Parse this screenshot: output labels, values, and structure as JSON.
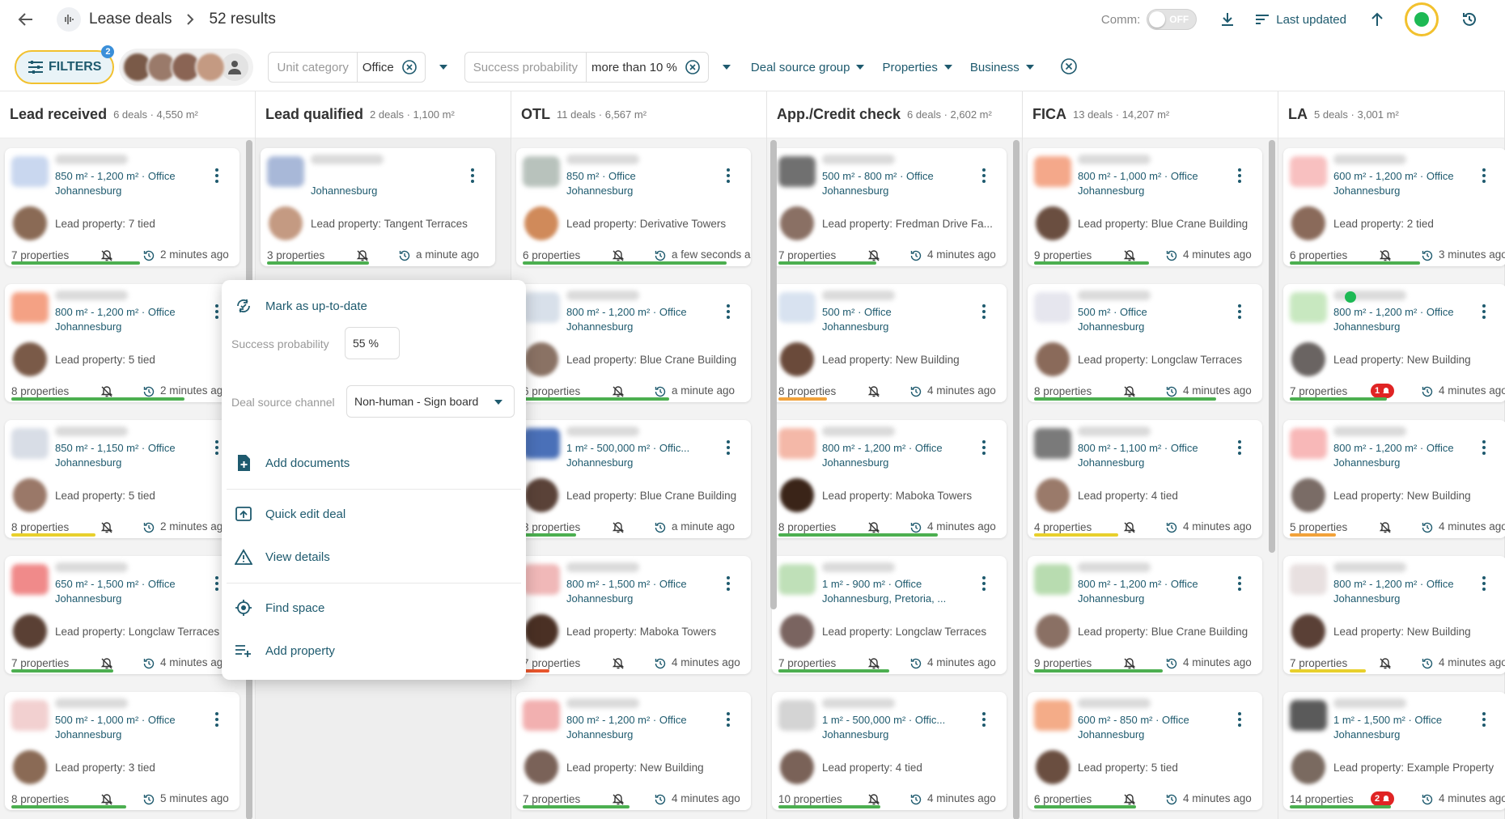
{
  "header": {
    "title": "Lease deals",
    "results": "52 results",
    "comm_label": "Comm:",
    "comm_toggle": "OFF",
    "sort_label": "Last updated"
  },
  "filters": {
    "button_label": "FILTERS",
    "badge": "2",
    "unit_category": {
      "label": "Unit category",
      "value": "Office"
    },
    "success_probability": {
      "label": "Success probability",
      "value": "more than 10 %"
    },
    "dropdowns": [
      "Deal source group",
      "Properties",
      "Business"
    ]
  },
  "columns": [
    {
      "title": "Lead received",
      "meta": "6 deals · 4,550 m²"
    },
    {
      "title": "Lead qualified",
      "meta": "2 deals · 1,100 m²"
    },
    {
      "title": "OTL",
      "meta": "11 deals · 6,567 m²"
    },
    {
      "title": "App./Credit check",
      "meta": "6 deals · 2,602 m²"
    },
    {
      "title": "FICA",
      "meta": "13 deals · 14,207 m²"
    },
    {
      "title": "LA",
      "meta": "5 deals · 3,001 m²"
    }
  ],
  "cards": [
    [
      {
        "size": "850 m² - 1,200 m² · Office",
        "city": "Johannesburg",
        "lead": "Lead property: 7 tied",
        "props": "7 properties",
        "time": "2 minutes ago",
        "bar": "#4caf50",
        "bar_fill": 0.58,
        "thumb": "#c9d7ef",
        "agent": "#8a6a55"
      },
      {
        "size": "800 m² - 1,200 m² · Office",
        "city": "Johannesburg",
        "lead": "Lead property: 5 tied",
        "props": "8 properties",
        "time": "2 minutes ago",
        "bar": "#4caf50",
        "bar_fill": 0.78,
        "thumb": "#f4a184",
        "agent": "#7a5a48"
      },
      {
        "size": "850 m² - 1,150 m² · Office",
        "city": "Johannesburg",
        "lead": "Lead property: 5 tied",
        "props": "8 properties",
        "time": "2 minutes ago",
        "bar": "#e8d02c",
        "bar_fill": 0.38,
        "thumb": "#d8dde6",
        "agent": "#9a7868"
      },
      {
        "size": "650 m² - 1,500 m² · Office",
        "city": "Johannesburg",
        "lead": "Lead property: Longclaw Terraces",
        "props": "7 properties",
        "time": "4 minutes ago",
        "bar": "#4caf50",
        "bar_fill": 0.46,
        "thumb": "#f08a8a",
        "agent": "#5a4034"
      },
      {
        "size": "500 m² - 1,000 m² · Office",
        "city": "Johannesburg",
        "lead": "Lead property: 3 tied",
        "props": "8 properties",
        "time": "5 minutes ago",
        "bar": "#4caf50",
        "bar_fill": 0.52,
        "thumb": "#f2d0d0",
        "agent": "#8a6a55"
      }
    ],
    [
      {
        "size": "",
        "city": "Johannesburg",
        "lead": "Lead property: Tangent Terraces",
        "props": "3 properties",
        "time": "a minute ago",
        "bar": "#4caf50",
        "bar_fill": 0.46,
        "thumb": "#a8b8d8",
        "agent": "#c49a82"
      }
    ],
    [
      {
        "size": "850 m² · Office",
        "city": "Johannesburg",
        "lead": "Lead property: Derivative Towers",
        "props": "6 properties",
        "time": "a few seconds ago",
        "bar": "#4caf50",
        "bar_fill": 0.92,
        "thumb": "#b8c2bc",
        "agent": "#d08a5a"
      },
      {
        "size": "800 m² - 1,200 m² · Office",
        "city": "Johannesburg",
        "lead": "Lead property: Blue Crane Building",
        "props": "6 properties",
        "time": "a minute ago",
        "bar": "#4caf50",
        "bar_fill": 0.66,
        "thumb": "#d8e0ea",
        "agent": "#8a7264"
      },
      {
        "size": "1 m² - 500,000 m² · Offic...",
        "city": "Johannesburg",
        "lead": "Lead property: Blue Crane Building",
        "props": "3 properties",
        "time": "a minute ago",
        "bar": "#4caf50",
        "bar_fill": 0.24,
        "thumb": "#4a70b8",
        "agent": "#5a4238"
      },
      {
        "size": "800 m² - 1,500 m² · Office",
        "city": "Johannesburg",
        "lead": "Lead property: Maboka Towers",
        "props": "7 properties",
        "time": "4 minutes ago",
        "bar": "#e8552c",
        "bar_fill": 0.12,
        "thumb": "#f0b8b8",
        "agent": "#4a3024"
      },
      {
        "size": "800 m² - 1,200 m² · Office",
        "city": "Johannesburg",
        "lead": "Lead property: New Building",
        "props": "7 properties",
        "time": "4 minutes ago",
        "bar": "#4caf50",
        "bar_fill": 0.48,
        "thumb": "#f2b0b0",
        "agent": "#7a6258"
      }
    ],
    [
      {
        "size": "500 m² - 800 m² · Office",
        "city": "Johannesburg",
        "lead": "Lead property: Fredman Drive Fa...",
        "props": "7 properties",
        "time": "4 minutes ago",
        "bar": "#4caf50",
        "bar_fill": 0.44,
        "thumb": "#707070",
        "agent": "#8a7064"
      },
      {
        "size": "500 m² · Office",
        "city": "Johannesburg",
        "lead": "Lead property: New Building",
        "props": "8 properties",
        "time": "4 minutes ago",
        "bar": "#f2a23a",
        "bar_fill": 0.22,
        "thumb": "#d8e2f0",
        "agent": "#6a4a3a"
      },
      {
        "size": "800 m² - 1,200 m² · Office",
        "city": "Johannesburg",
        "lead": "Lead property: Maboka Towers",
        "props": "8 properties",
        "time": "4 minutes ago",
        "bar": "#4caf50",
        "bar_fill": 0.72,
        "thumb": "#f4b8a8",
        "agent": "#3a2418"
      },
      {
        "size": "1 m² - 900 m² · Office",
        "city": "Johannesburg, Pretoria, ...",
        "lead": "Lead property: Longclaw Terraces",
        "props": "7 properties",
        "time": "4 minutes ago",
        "bar": "#4caf50",
        "bar_fill": 0.5,
        "thumb": "#bfe0b8",
        "agent": "#7a6460"
      },
      {
        "size": "1 m² - 500,000 m² · Offic...",
        "city": "Johannesburg",
        "lead": "Lead property: 4 tied",
        "props": "10 properties",
        "time": "4 minutes ago",
        "bar": "#4caf50",
        "bar_fill": 0.46,
        "thumb": "#d4d4d4",
        "agent": "#7a6258"
      }
    ],
    [
      {
        "size": "800 m² - 1,000 m² · Office",
        "city": "Johannesburg",
        "lead": "Lead property: Blue Crane Building",
        "props": "9 properties",
        "time": "4 minutes ago",
        "bar": "#4caf50",
        "bar_fill": 0.52,
        "thumb": "#f4a88a",
        "agent": "#6a4e40"
      },
      {
        "size": "500 m² · Office",
        "city": "Johannesburg",
        "lead": "Lead property: Longclaw Terraces",
        "props": "8 properties",
        "time": "4 minutes ago",
        "bar": "#4caf50",
        "bar_fill": 0.82,
        "thumb": "#e6e6ee",
        "agent": "#8a6a5a"
      },
      {
        "size": "800 m² - 1,100 m² · Office",
        "city": "Johannesburg",
        "lead": "Lead property: 4 tied",
        "props": "4 properties",
        "time": "4 minutes ago",
        "bar": "#e8d02c",
        "bar_fill": 0.38,
        "thumb": "#7a7a7a",
        "agent": "#9a7a6a"
      },
      {
        "size": "800 m² - 1,200 m² · Office",
        "city": "Johannesburg",
        "lead": "Lead property: Blue Crane Building",
        "props": "9 properties",
        "time": "4 minutes ago",
        "bar": "#4caf50",
        "bar_fill": 0.58,
        "thumb": "#b8dcb0",
        "agent": "#8a7064"
      },
      {
        "size": "600 m² - 850 m² · Office",
        "city": "Johannesburg",
        "lead": "Lead property: 5 tied",
        "props": "6 properties",
        "time": "4 minutes ago",
        "bar": "#4caf50",
        "bar_fill": 0.46,
        "thumb": "#f4ac88",
        "agent": "#6a4e40"
      }
    ],
    [
      {
        "size": "600 m² - 1,200 m² · Office",
        "city": "Johannesburg",
        "lead": "Lead property: 2 tied",
        "props": "6 properties",
        "time": "3 minutes ago",
        "bar": "#4caf50",
        "bar_fill": 0.62,
        "thumb": "#f8c0c0",
        "agent": "#8a6a5a",
        "time_clip": true
      },
      {
        "size": "800 m² - 1,200 m² · Office",
        "city": "Johannesburg",
        "lead": "Lead property: New Building",
        "props": "7 properties",
        "time": "4 minutes ago",
        "bar": "#4caf50",
        "bar_fill": 0.46,
        "thumb": "#c8e8c0",
        "agent": "#6a6462",
        "alert": "1",
        "check": true
      },
      {
        "size": "800 m² - 1,200 m² · Office",
        "city": "Johannesburg",
        "lead": "Lead property: New Building",
        "props": "5 properties",
        "time": "4 minutes ago",
        "bar": "#f2a23a",
        "bar_fill": 0.22,
        "thumb": "#f8b8b8",
        "agent": "#7a6c66"
      },
      {
        "size": "800 m² - 1,200 m² · Office",
        "city": "Johannesburg",
        "lead": "Lead property: New Building",
        "props": "7 properties",
        "time": "4 minutes ago",
        "bar": "#e8d02c",
        "bar_fill": 0.36,
        "thumb": "#e8e0e0",
        "agent": "#5a4036"
      },
      {
        "size": "1 m² - 1,500 m² · Office",
        "city": "Johannesburg",
        "lead": "Lead property: Example Property",
        "props": "14 properties",
        "time": "4 minutes ago",
        "bar": "#4caf50",
        "bar_fill": 0.48,
        "thumb": "#5a5a5a",
        "agent": "#7a6a60",
        "alert": "2"
      }
    ]
  ],
  "menu": {
    "mark_up_to_date": "Mark as up-to-date",
    "success_probability_label": "Success probability",
    "success_probability_value": "55 %",
    "deal_source_label": "Deal source channel",
    "deal_source_value": "Non-human - Sign board",
    "add_documents": "Add documents",
    "quick_edit": "Quick edit deal",
    "view_details": "View details",
    "find_space": "Find space",
    "add_property": "Add property"
  },
  "colors": {
    "accent": "#1e5a6e",
    "highlight": "#f2c12e",
    "status": "#1db954"
  }
}
